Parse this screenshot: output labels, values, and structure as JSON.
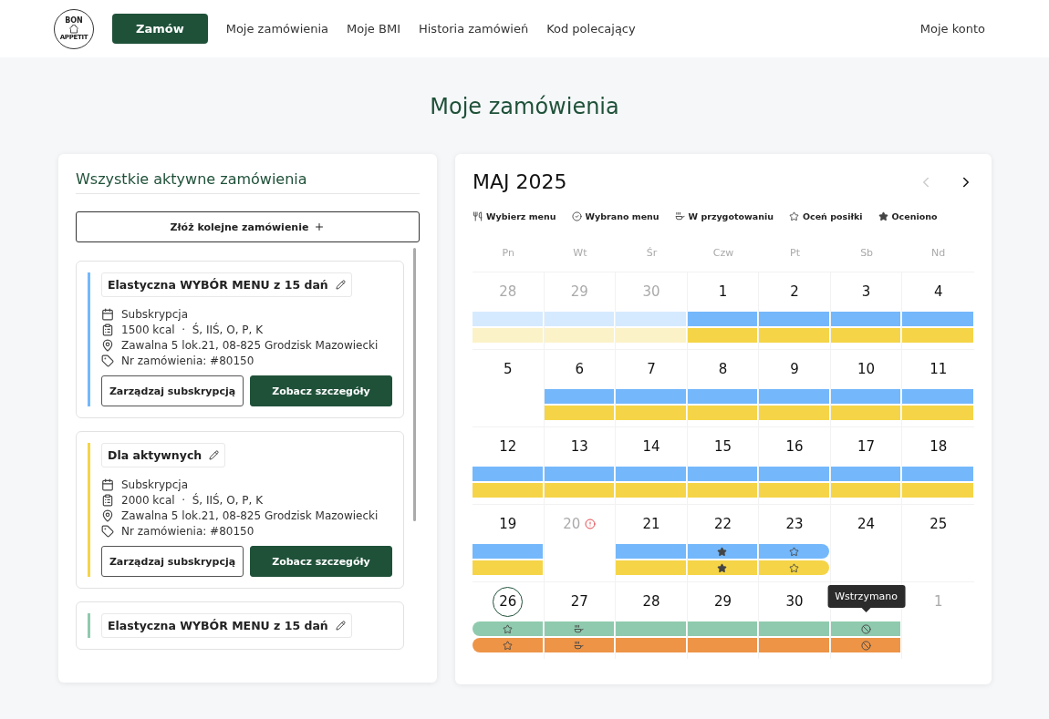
{
  "header": {
    "logo": {
      "top": "BON",
      "bottom": "APPETIT"
    },
    "nav": [
      {
        "label": "Zamów",
        "kind": "cta",
        "selected": true
      },
      {
        "label": "Moje zamówienia",
        "kind": "link",
        "selected": false
      },
      {
        "label": "Moje BMI",
        "kind": "link",
        "selected": false
      },
      {
        "label": "Historia zamówień",
        "kind": "link",
        "selected": false
      },
      {
        "label": "Kod polecający",
        "kind": "link",
        "selected": false
      }
    ],
    "account": "Moje konto"
  },
  "page_title": "Moje zamówienia",
  "orders_panel": {
    "title": "Wszystkie aktywne zamówienia",
    "new_order_button": "Złóż kolejne zamówienie",
    "orders": [
      {
        "name": "Elastyczna WYBÓR MENU z 15 dań",
        "color": "#74b8fb",
        "details": [
          {
            "kind": "subscription",
            "text": "Subskrypcja"
          },
          {
            "kind": "diet",
            "text": "1500 kcal  ·  Ś, IIŚ, O, P, K"
          },
          {
            "kind": "address",
            "text": "Zawalna 5 lok.21, 08-825 Grodzisk Mazowiecki"
          },
          {
            "kind": "order-number",
            "text": "Nr zamówienia: #80150"
          }
        ],
        "buttons": [
          {
            "label": "Zarządzaj subskrypcją",
            "kind": "outline"
          },
          {
            "label": "Zobacz szczegóły",
            "kind": "primary"
          }
        ]
      },
      {
        "name": "Dla aktywnych",
        "color": "#f5d547",
        "details": [
          {
            "kind": "subscription",
            "text": "Subskrypcja"
          },
          {
            "kind": "diet",
            "text": "2000 kcal  ·  Ś, IIŚ, O, P, K"
          },
          {
            "kind": "address",
            "text": "Zawalna 5 lok.21, 08-825 Grodzisk Mazowiecki"
          },
          {
            "kind": "order-number",
            "text": "Nr zamówienia: #80150"
          }
        ],
        "buttons": [
          {
            "label": "Zarządzaj subskrypcją",
            "kind": "outline"
          },
          {
            "label": "Zobacz szczegóły",
            "kind": "primary"
          }
        ]
      },
      {
        "name": "Elastyczna WYBÓR MENU z 15 dań",
        "color": "#8fcaae"
      }
    ]
  },
  "calendar": {
    "month": "MAJ 2025",
    "prev_disabled": true,
    "legend": [
      {
        "kind": "choose",
        "label": "Wybierz menu"
      },
      {
        "kind": "chosen",
        "label": "Wybrano menu"
      },
      {
        "kind": "preparing",
        "label": "W przygotowaniu"
      },
      {
        "kind": "to-rate",
        "label": "Oceń posiłki"
      },
      {
        "kind": "rated",
        "label": "Oceniono"
      }
    ],
    "weekdays": [
      "Pn",
      "Wt",
      "Śr",
      "Czw",
      "Pt",
      "Sb",
      "Nd"
    ],
    "weeks": [
      {
        "days": [
          {
            "label": "28",
            "muted": true
          },
          {
            "label": "29",
            "muted": true
          },
          {
            "label": "30",
            "muted": true
          },
          {
            "label": "1",
            "muted": false
          },
          {
            "label": "2",
            "muted": false
          },
          {
            "label": "3",
            "muted": false
          },
          {
            "label": "4",
            "muted": false
          }
        ],
        "lanes": [
          {
            "color": "#74b8fb",
            "cells": [
              {
                "kind": "faded"
              },
              {
                "kind": "faded"
              },
              {
                "kind": "faded"
              },
              {
                "kind": "plain"
              },
              {
                "kind": "plain"
              },
              {
                "kind": "plain"
              },
              {
                "kind": "plain"
              }
            ]
          },
          {
            "color": "#f5d547",
            "cells": [
              {
                "kind": "faded"
              },
              {
                "kind": "faded"
              },
              {
                "kind": "faded"
              },
              {
                "kind": "plain"
              },
              {
                "kind": "plain"
              },
              {
                "kind": "plain"
              },
              {
                "kind": "plain"
              }
            ]
          }
        ]
      },
      {
        "days": [
          {
            "label": "5"
          },
          {
            "label": "6"
          },
          {
            "label": "7"
          },
          {
            "label": "8"
          },
          {
            "label": "9"
          },
          {
            "label": "10"
          },
          {
            "label": "11"
          }
        ],
        "lanes": [
          {
            "color": "#74b8fb",
            "cells": [
              {
                "kind": "empty"
              },
              {
                "kind": "plain"
              },
              {
                "kind": "plain"
              },
              {
                "kind": "plain"
              },
              {
                "kind": "plain"
              },
              {
                "kind": "plain"
              },
              {
                "kind": "plain"
              }
            ]
          },
          {
            "color": "#f5d547",
            "cells": [
              {
                "kind": "empty"
              },
              {
                "kind": "plain"
              },
              {
                "kind": "plain"
              },
              {
                "kind": "plain"
              },
              {
                "kind": "plain"
              },
              {
                "kind": "plain"
              },
              {
                "kind": "plain"
              }
            ]
          }
        ]
      },
      {
        "days": [
          {
            "label": "12"
          },
          {
            "label": "13"
          },
          {
            "label": "14"
          },
          {
            "label": "15"
          },
          {
            "label": "16"
          },
          {
            "label": "17"
          },
          {
            "label": "18"
          }
        ],
        "lanes": [
          {
            "color": "#74b8fb",
            "cells": [
              {
                "kind": "plain"
              },
              {
                "kind": "plain"
              },
              {
                "kind": "plain"
              },
              {
                "kind": "plain"
              },
              {
                "kind": "plain"
              },
              {
                "kind": "plain"
              },
              {
                "kind": "plain"
              }
            ]
          },
          {
            "color": "#f5d547",
            "cells": [
              {
                "kind": "plain"
              },
              {
                "kind": "plain"
              },
              {
                "kind": "plain"
              },
              {
                "kind": "plain"
              },
              {
                "kind": "plain"
              },
              {
                "kind": "plain"
              },
              {
                "kind": "plain"
              }
            ]
          }
        ]
      },
      {
        "days": [
          {
            "label": "19"
          },
          {
            "label": "20",
            "muted": true,
            "alert": true
          },
          {
            "label": "21"
          },
          {
            "label": "22"
          },
          {
            "label": "23"
          },
          {
            "label": "24"
          },
          {
            "label": "25"
          }
        ],
        "lanes": [
          {
            "color": "#74b8fb",
            "cells": [
              {
                "kind": "plain"
              },
              {
                "kind": "empty"
              },
              {
                "kind": "plain"
              },
              {
                "kind": "rated"
              },
              {
                "kind": "to-rate",
                "range_end": true
              },
              {
                "kind": "empty"
              },
              {
                "kind": "empty"
              }
            ]
          },
          {
            "color": "#f5d547",
            "cells": [
              {
                "kind": "plain"
              },
              {
                "kind": "empty"
              },
              {
                "kind": "plain"
              },
              {
                "kind": "rated"
              },
              {
                "kind": "to-rate",
                "range_end": true
              },
              {
                "kind": "empty"
              },
              {
                "kind": "empty"
              }
            ]
          }
        ]
      },
      {
        "days": [
          {
            "label": "26",
            "today": true
          },
          {
            "label": "27"
          },
          {
            "label": "28"
          },
          {
            "label": "29"
          },
          {
            "label": "30"
          },
          {
            "tooltip": "Wstrzymano"
          },
          {
            "label": "1",
            "muted": true
          }
        ],
        "lanes": [
          {
            "color": "#8fcaae",
            "cells": [
              {
                "kind": "to-rate",
                "range_start": true
              },
              {
                "kind": "preparing"
              },
              {
                "kind": "plain"
              },
              {
                "kind": "plain"
              },
              {
                "kind": "plain"
              },
              {
                "kind": "paused"
              },
              {
                "kind": "empty"
              }
            ]
          },
          {
            "color": "#ee9447",
            "cells": [
              {
                "kind": "to-rate",
                "range_start": true
              },
              {
                "kind": "preparing"
              },
              {
                "kind": "plain"
              },
              {
                "kind": "plain"
              },
              {
                "kind": "plain"
              },
              {
                "kind": "paused"
              },
              {
                "kind": "empty"
              }
            ]
          }
        ]
      }
    ]
  }
}
